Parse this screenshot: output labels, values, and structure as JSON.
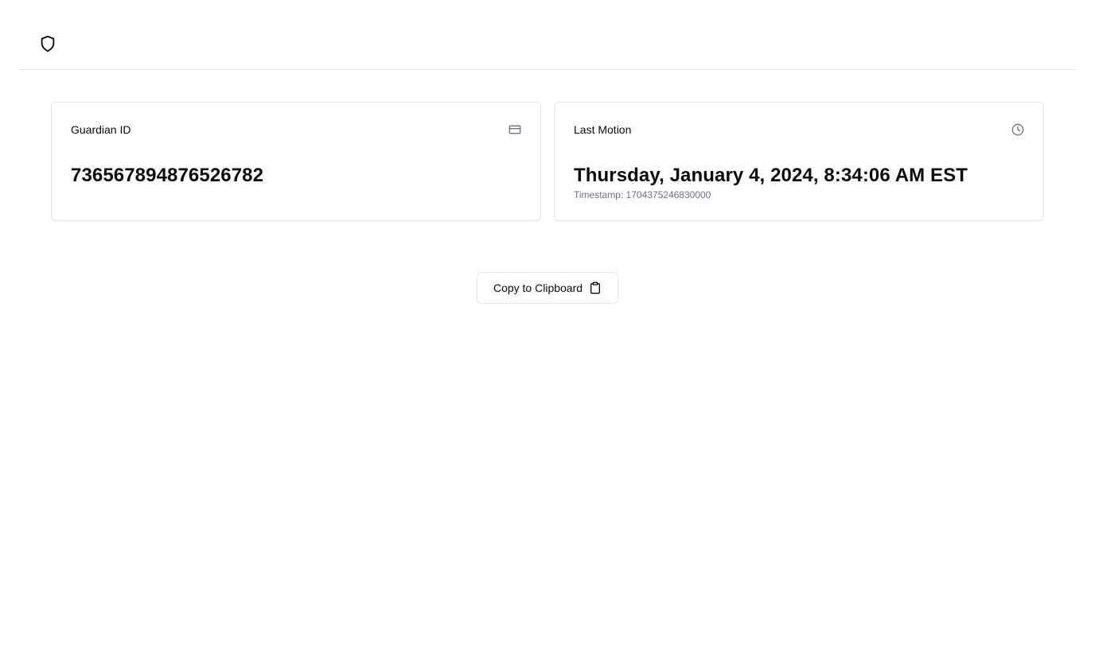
{
  "header": {
    "logo_icon": "shield-icon"
  },
  "cards": {
    "guardian": {
      "label": "Guardian ID",
      "icon": "credit-card-icon",
      "value": "736567894876526782"
    },
    "motion": {
      "label": "Last Motion",
      "icon": "clock-icon",
      "value": "Thursday, January 4, 2024, 8:34:06 AM EST",
      "timestamp_label": "Timestamp: 1704375246830000"
    }
  },
  "actions": {
    "copy_label": "Copy to Clipboard",
    "copy_icon": "clipboard-icon"
  },
  "colors": {
    "text": "#0a0a0a",
    "muted": "#6b7280",
    "border": "#e5e7eb",
    "background": "#ffffff"
  }
}
